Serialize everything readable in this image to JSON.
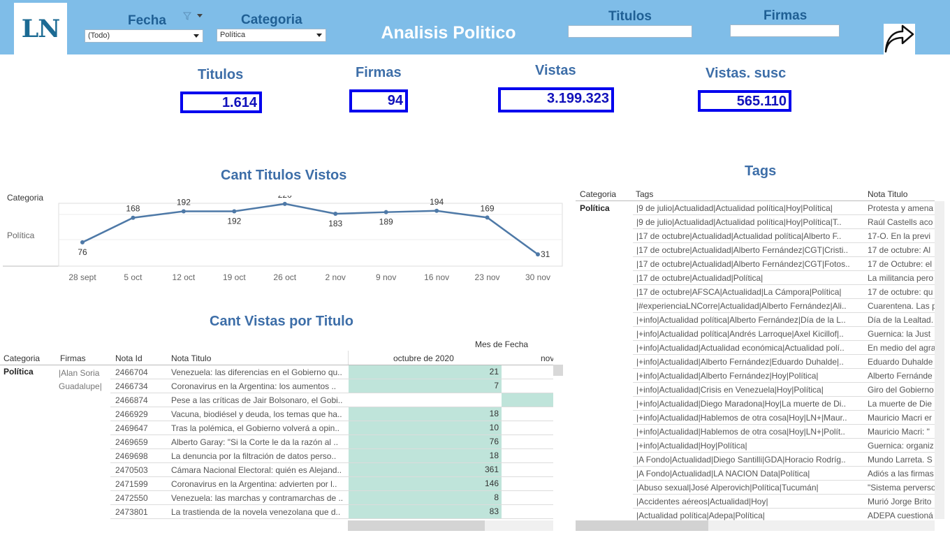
{
  "header": {
    "logo_text": "LN",
    "app_title": "Analisis Politico",
    "fecha": {
      "label": "Fecha",
      "value": "(Todo)"
    },
    "categoria": {
      "label": "Categoria",
      "value": "Política"
    },
    "titulos": {
      "label": "Titulos",
      "value": ""
    },
    "firmas": {
      "label": "Firmas",
      "value": ""
    }
  },
  "kpis": [
    {
      "label": "Titulos",
      "value": "1.614"
    },
    {
      "label": "Firmas",
      "value": "94"
    },
    {
      "label": "Vistas",
      "value": "3.199.323"
    },
    {
      "label": "Vistas. susc",
      "value": "565.110"
    }
  ],
  "line_section": {
    "title": "Cant Titulos Vistos",
    "row_header": "Categoria",
    "row_label": "Política"
  },
  "chart_data": {
    "type": "line",
    "title": "Cant Titulos Vistos",
    "categories": [
      "28 sept",
      "5 oct",
      "12 oct",
      "19 oct",
      "26 oct",
      "2 nov",
      "9 nov",
      "16 nov",
      "23 nov",
      "30 nov"
    ],
    "values": [
      76,
      168,
      192,
      192,
      220,
      183,
      189,
      194,
      169,
      31
    ],
    "series": [
      {
        "values": [
          76,
          168,
          192,
          192,
          220,
          183,
          189,
          194,
          169,
          31
        ]
      }
    ],
    "ylim": [
      0,
      230
    ],
    "grid": true,
    "color": "#4e79a7"
  },
  "vistas_table": {
    "title": "Cant Vistas por Titulo",
    "col_group": "Mes de Fecha",
    "headers": [
      "Categoria",
      "Firmas",
      "Nota Id",
      "Nota Titulo"
    ],
    "months": [
      "octubre de 2020",
      "nov"
    ],
    "categoria": "Política",
    "firma": "|Alan Soria Guadalupe|",
    "rows": [
      {
        "id": "2466704",
        "titulo": "Venezuela: las diferencias en el Gobierno qu..",
        "oct": "21"
      },
      {
        "id": "2466734",
        "titulo": "Coronavirus en la Argentina: los aumentos ..",
        "oct": "7"
      },
      {
        "id": "2466874",
        "titulo": "Pese a las críticas de Jair Bolsonaro, el Gobi..",
        "oct": ""
      },
      {
        "id": "2466929",
        "titulo": "Vacuna, biodiésel y deuda, los temas que ha..",
        "oct": "18"
      },
      {
        "id": "2469647",
        "titulo": "Tras la polémica, el Gobierno volverá a opin..",
        "oct": "10"
      },
      {
        "id": "2469659",
        "titulo": "Alberto Garay: \"Si la Corte le da la razón al ..",
        "oct": "76"
      },
      {
        "id": "2469698",
        "titulo": "La denuncia por la filtración de datos perso..",
        "oct": "18"
      },
      {
        "id": "2470503",
        "titulo": "Cámara Nacional Electoral: quién es Alejand..",
        "oct": "361"
      },
      {
        "id": "2471599",
        "titulo": "Coronavirus en la Argentina: advierten por l..",
        "oct": "146"
      },
      {
        "id": "2472550",
        "titulo": "Venezuela: las marchas y contramarchas de ..",
        "oct": "8"
      },
      {
        "id": "2473801",
        "titulo": "La trastienda de la novela venezolana que d..",
        "oct": "83"
      }
    ],
    "fill_color": "#bfe4da"
  },
  "tags_table": {
    "title": "Tags",
    "headers": [
      "Categoria",
      "Tags",
      "Nota Titulo"
    ],
    "categoria": "Política",
    "rows": [
      {
        "tags": "|9 de julio|Actualidad|Actualidad política|Hoy|Política|",
        "titulo": "Protesta y amena"
      },
      {
        "tags": "|9 de julio|Actualidad|Actualidad política|Hoy|Política|T..",
        "titulo": "Raúl Castells aco"
      },
      {
        "tags": "|17 de octubre|Actualidad|Actualidad política|Alberto F..",
        "titulo": "17-O. En la previ"
      },
      {
        "tags": "|17 de octubre|Actualidad|Alberto Fernández|CGT|Cristi..",
        "titulo": "17 de octubre: Al"
      },
      {
        "tags": "|17 de octubre|Actualidad|Alberto Fernández|CGT|Fotos..",
        "titulo": "17 de Octubre: el"
      },
      {
        "tags": "|17 de octubre|Actualidad|Política|",
        "titulo": "La militancia pero"
      },
      {
        "tags": "|17 de octubre|AFSCA|Actualidad|La Cámpora|Política|",
        "titulo": "17 de octubre: qu"
      },
      {
        "tags": "|#experienciaLNCorre|Actualidad|Alberto Fernández|Ali..",
        "titulo": "Cuarentena. Las p"
      },
      {
        "tags": "|+info|Actualidad política|Alberto Fernández|Día de la L..",
        "titulo": "Día de la Lealtad."
      },
      {
        "tags": "|+info|Actualidad política|Andrés Larroque|Axel Kicillof|..",
        "titulo": "Guernica: la Just"
      },
      {
        "tags": "|+info|Actualidad|Actualidad económica|Actualidad polí..",
        "titulo": "En medio del agra"
      },
      {
        "tags": "|+info|Actualidad|Alberto Fernández|Eduardo Duhalde|..",
        "titulo": "Eduardo Duhalde"
      },
      {
        "tags": "|+info|Actualidad|Alberto Fernández|Hoy|Política|",
        "titulo": "Alberto Fernánde"
      },
      {
        "tags": "|+info|Actualidad|Crisis en Venezuela|Hoy|Política|",
        "titulo": "Giro del Gobierno"
      },
      {
        "tags": "|+info|Actualidad|Diego Maradona|Hoy|La muerte de Di..",
        "titulo": "La muerte de Die"
      },
      {
        "tags": "|+info|Actualidad|Hablemos de otra cosa|Hoy|LN+|Maur..",
        "titulo": "Mauricio Macri er"
      },
      {
        "tags": "|+info|Actualidad|Hablemos de otra cosa|Hoy|LN+|Polít..",
        "titulo": "Mauricio Macri: \""
      },
      {
        "tags": "|+info|Actualidad|Hoy|Política|",
        "titulo": "Guernica: organiz"
      },
      {
        "tags": "|A Fondo|Actualidad|Diego Santilli|GDA|Horacio Rodríg..",
        "titulo": "Mundo Larreta. S"
      },
      {
        "tags": "|A Fondo|Actualidad|LA NACION Data|Política|",
        "titulo": "Adiós a las firmas"
      },
      {
        "tags": "|Abuso sexual|José Alperovich|Política|Tucumán|",
        "titulo": "\"Sistema perverso"
      },
      {
        "tags": "|Accidentes aéreos|Actualidad|Hoy|",
        "titulo": "Murió Jorge Brito"
      },
      {
        "tags": "|Actualidad política|Adepa|Política|",
        "titulo": "ADEPA cuestioná"
      }
    ]
  }
}
